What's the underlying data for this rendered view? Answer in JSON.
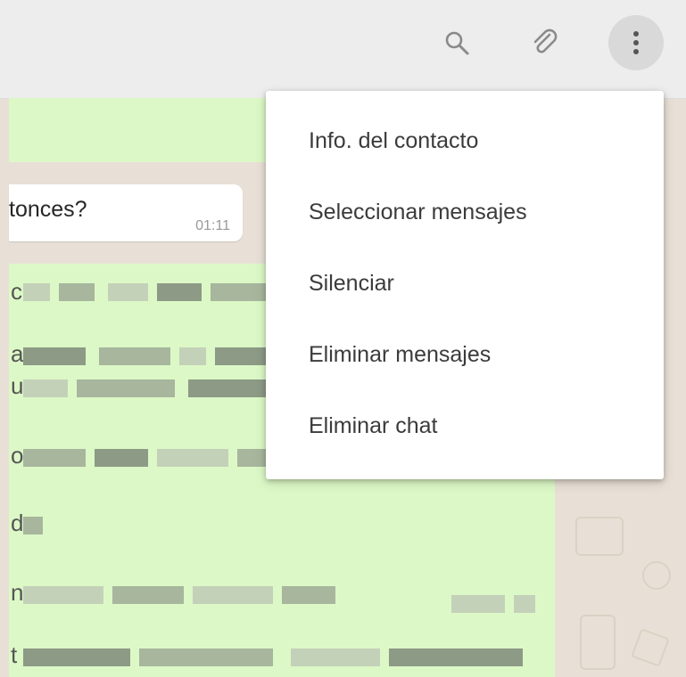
{
  "header": {
    "search_icon": "search-icon",
    "attach_icon": "paperclip-icon",
    "menu_icon": "kebab-menu-icon"
  },
  "chat": {
    "incoming_message": {
      "text": "tonces?",
      "time": "01:11"
    },
    "outgoing_message_letters": [
      "c",
      "a",
      "u",
      "o",
      "d",
      "n",
      "t"
    ]
  },
  "menu": {
    "items": [
      {
        "label": "Info. del contacto"
      },
      {
        "label": "Seleccionar mensajes"
      },
      {
        "label": "Silenciar"
      },
      {
        "label": "Eliminar mensajes"
      },
      {
        "label": "Eliminar chat"
      }
    ]
  },
  "colors": {
    "header_bg": "#ededed",
    "outgoing_bubble": "#dcf8c6",
    "incoming_bubble": "#ffffff",
    "chat_bg": "#e8e0d6"
  }
}
